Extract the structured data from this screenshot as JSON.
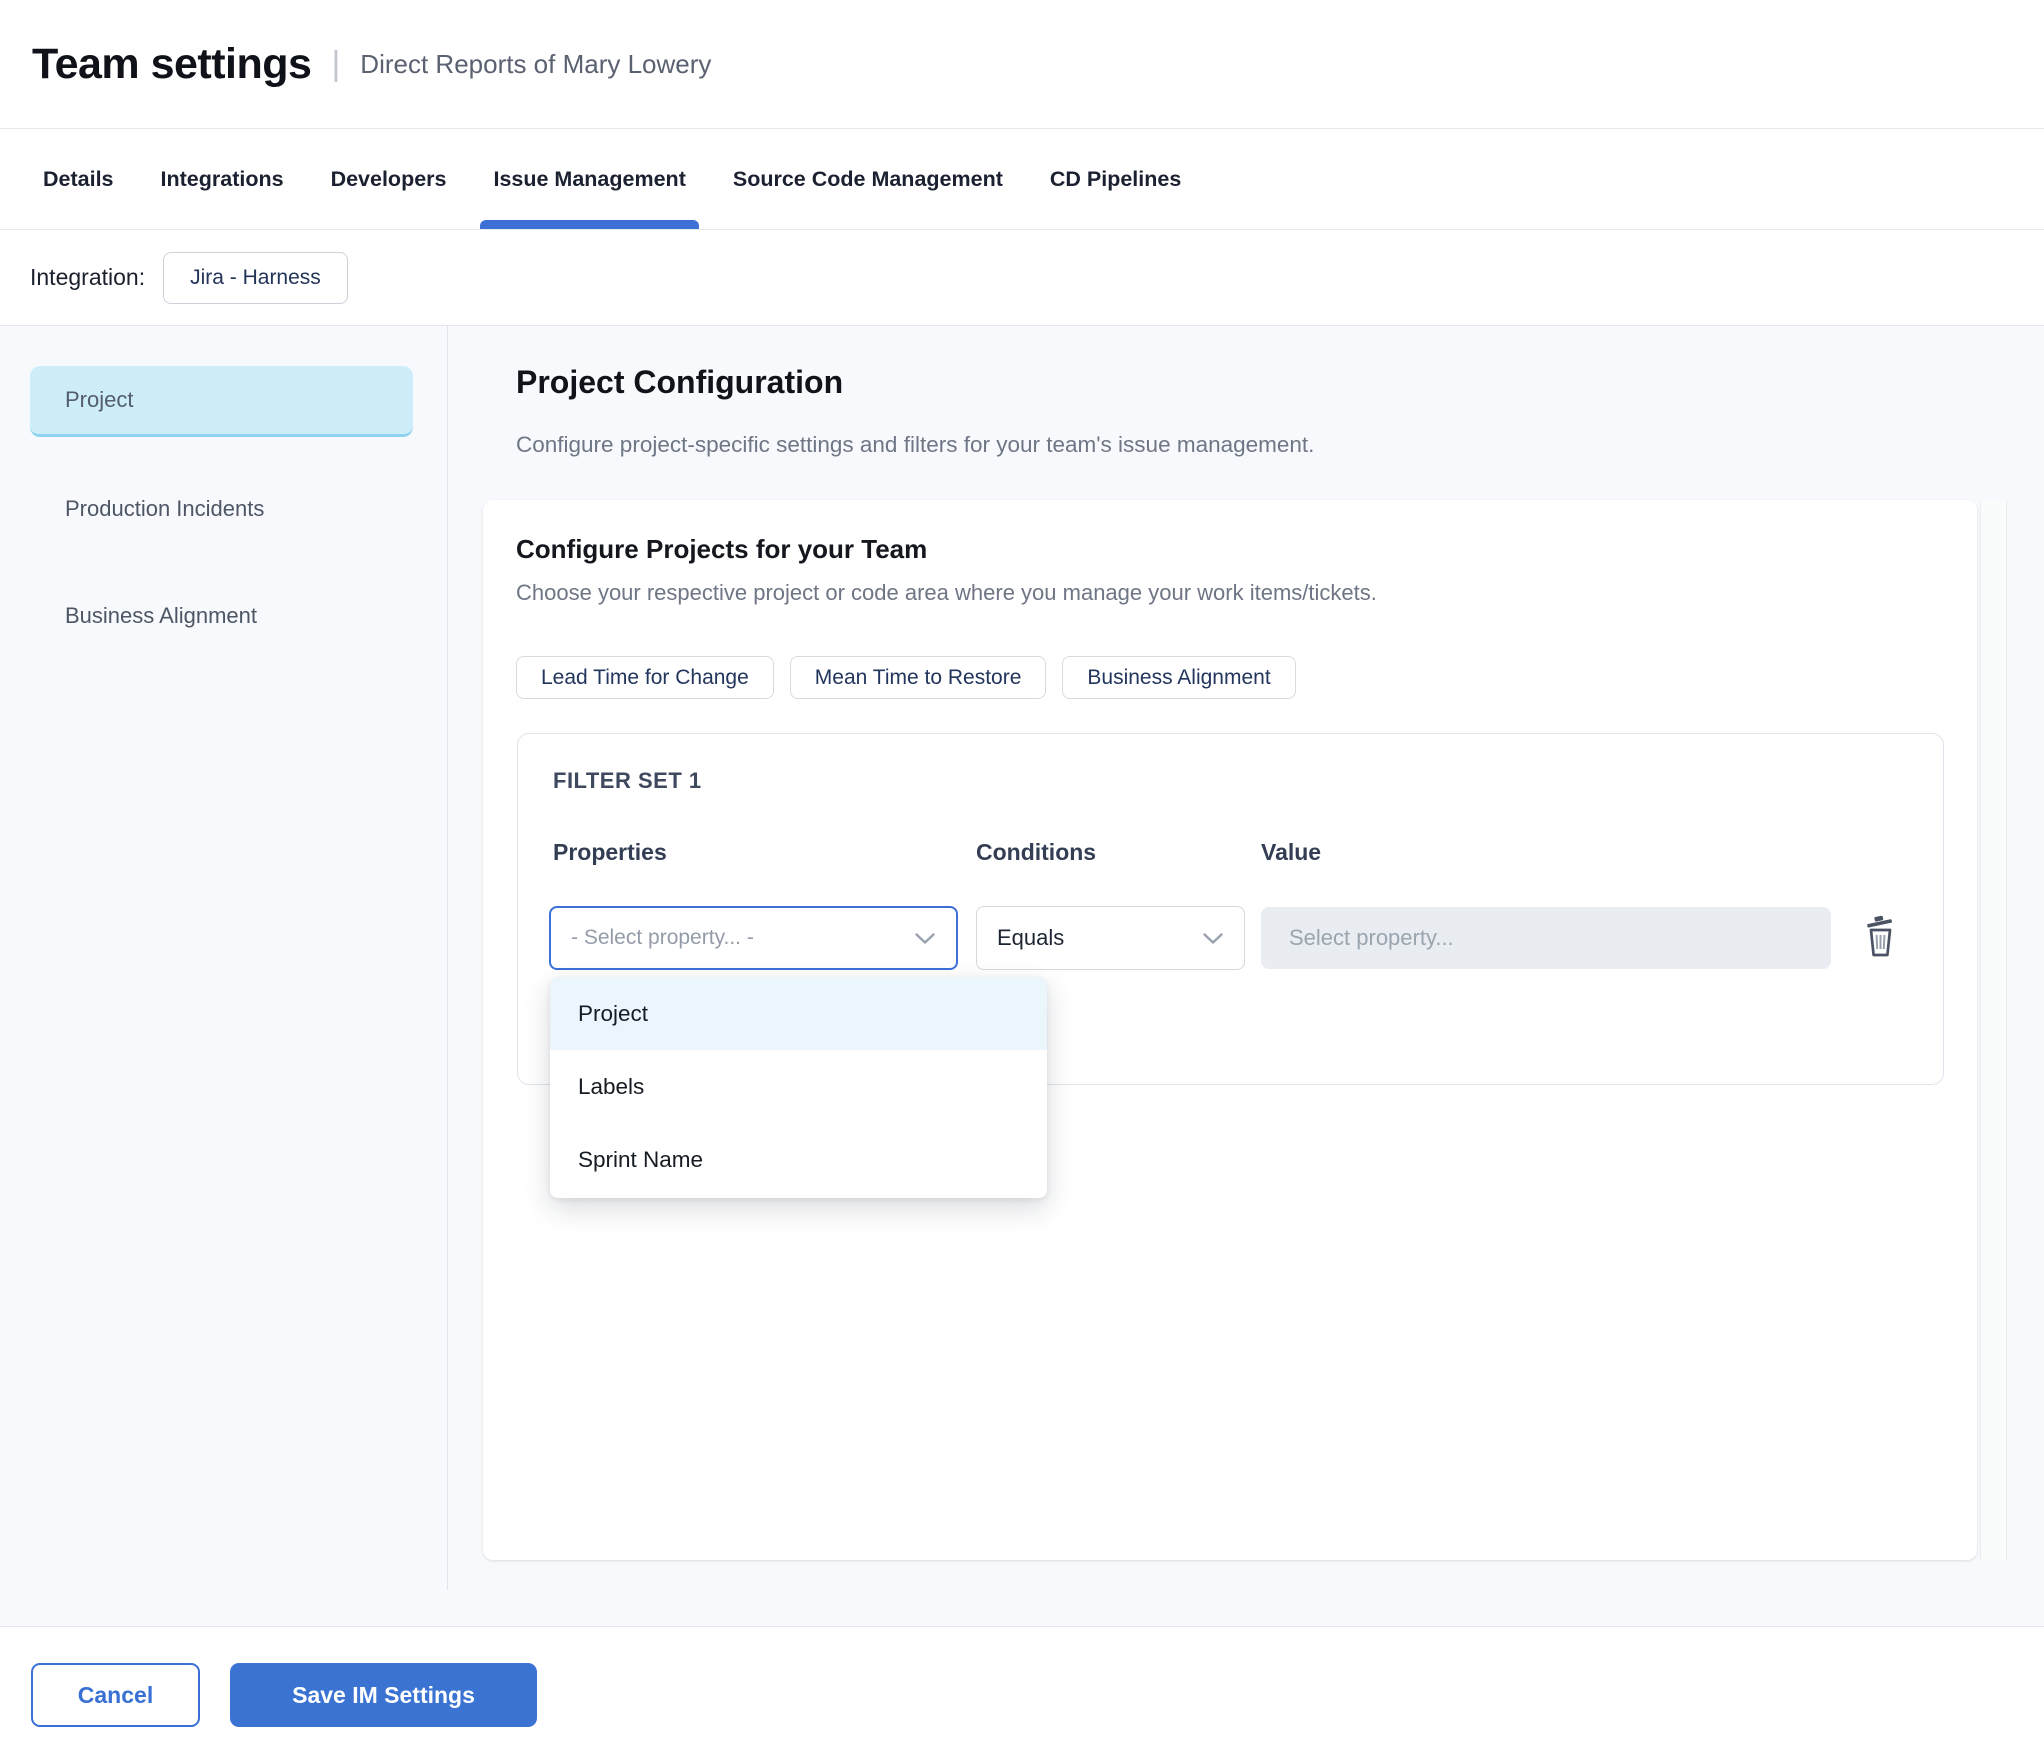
{
  "header": {
    "title": "Team settings",
    "separator": "|",
    "subtitle": "Direct Reports of Mary Lowery"
  },
  "tabs": {
    "items": [
      {
        "label": "Details",
        "active": false
      },
      {
        "label": "Integrations",
        "active": false
      },
      {
        "label": "Developers",
        "active": false
      },
      {
        "label": "Issue Management",
        "active": true
      },
      {
        "label": "Source Code Management",
        "active": false
      },
      {
        "label": "CD Pipelines",
        "active": false
      }
    ]
  },
  "integration": {
    "label": "Integration:",
    "chip": "Jira - Harness"
  },
  "sidebar": {
    "items": [
      {
        "label": "Project",
        "selected": true
      },
      {
        "label": "Production Incidents",
        "selected": false
      },
      {
        "label": "Business Alignment",
        "selected": false
      }
    ]
  },
  "main": {
    "title": "Project Configuration",
    "description": "Configure project-specific settings and filters for your team's issue management.",
    "card": {
      "title": "Configure Projects for your Team",
      "description": "Choose your respective project or code area where you manage your work items/tickets.",
      "chips": [
        "Lead Time for Change",
        "Mean Time to Restore",
        "Business Alignment"
      ],
      "filter_set": {
        "title": "FILTER SET 1",
        "columns": {
          "properties": "Properties",
          "conditions": "Conditions",
          "value": "Value"
        },
        "property_placeholder": "- Select property... -",
        "condition_value": "Equals",
        "value_placeholder": "Select property...",
        "dropdown": {
          "options": [
            {
              "label": "Project",
              "highlighted": true
            },
            {
              "label": "Labels",
              "highlighted": false
            },
            {
              "label": "Sprint Name",
              "highlighted": false
            }
          ]
        }
      }
    }
  },
  "footer": {
    "cancel_label": "Cancel",
    "save_label": "Save IM Settings"
  },
  "colors": {
    "accent_blue": "#3a73d1",
    "tab_underline": "#3c70d6",
    "focus_border": "#3b70d8",
    "selected_sidebar_bg": "#cdeef9",
    "selected_sidebar_edge": "#8ed3ef",
    "dropdown_highlight": "#ebf6fc",
    "value_input_bg": "#e9edf1",
    "page_background": "#f8f9fc",
    "chip_text": "#22355d"
  }
}
